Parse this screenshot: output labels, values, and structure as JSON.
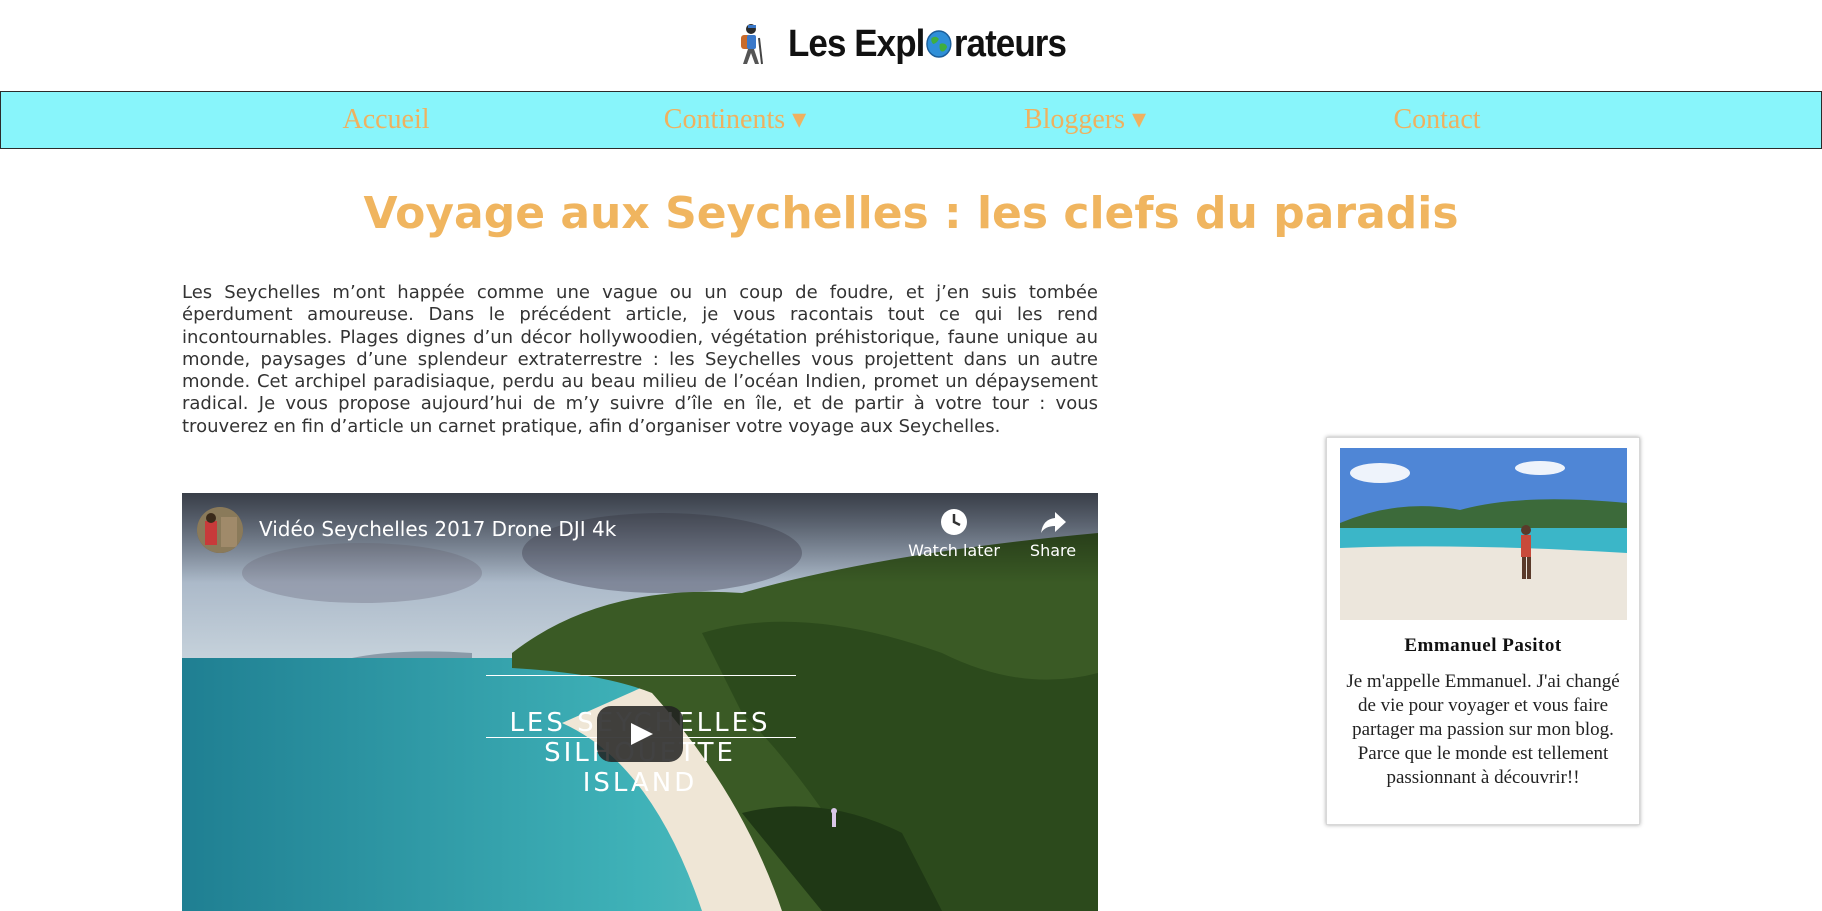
{
  "header": {
    "logo_text_before": "Les Expl",
    "logo_text_after": "rateurs"
  },
  "nav": {
    "items": [
      {
        "label": "Accueil",
        "has_dropdown": false
      },
      {
        "label": "Continents ▾",
        "has_dropdown": true
      },
      {
        "label": "Bloggers ▾",
        "has_dropdown": true
      },
      {
        "label": "Contact",
        "has_dropdown": false
      }
    ]
  },
  "article": {
    "title": "Voyage aux Seychelles : les clefs du paradis",
    "intro": "Les Seychelles m’ont happée comme une vague ou un coup de foudre, et j’en suis tombée éperdument amoureuse. Dans le précédent article, je vous racontais tout ce qui les rend incontournables. Plages dignes d’un décor hollywoodien, végétation préhistorique, faune unique au monde, paysages d’une splendeur extraterrestre : les Seychelles vous projettent dans un autre monde. Cet archipel paradisiaque, perdu au beau milieu de l’océan Indien, promet un dépaysement radical. Je vous propose aujourd’hui de m’y suivre d’île en île, et de partir à votre tour : vous trouverez en fin d’article un carnet pratique, afin d’organiser votre voyage aux Seychelles."
  },
  "video": {
    "title": "Vidéo Seychelles 2017 Drone DJI 4k",
    "watch_later_label": "Watch later",
    "share_label": "Share",
    "overlay_line1": "LES SEYCHELLES",
    "overlay_line2": "SILHOUETTE ISLAND"
  },
  "author_card": {
    "name": "Emmanuel Pasitot",
    "bio": "Je m'appelle Emmanuel. J'ai changé de vie pour voyager et vous faire partager ma passion sur mon blog. Parce que le monde est tellement passionnant à découvrir!!"
  },
  "colors": {
    "nav_background": "#88f5fb",
    "accent": "#f0b55f"
  }
}
